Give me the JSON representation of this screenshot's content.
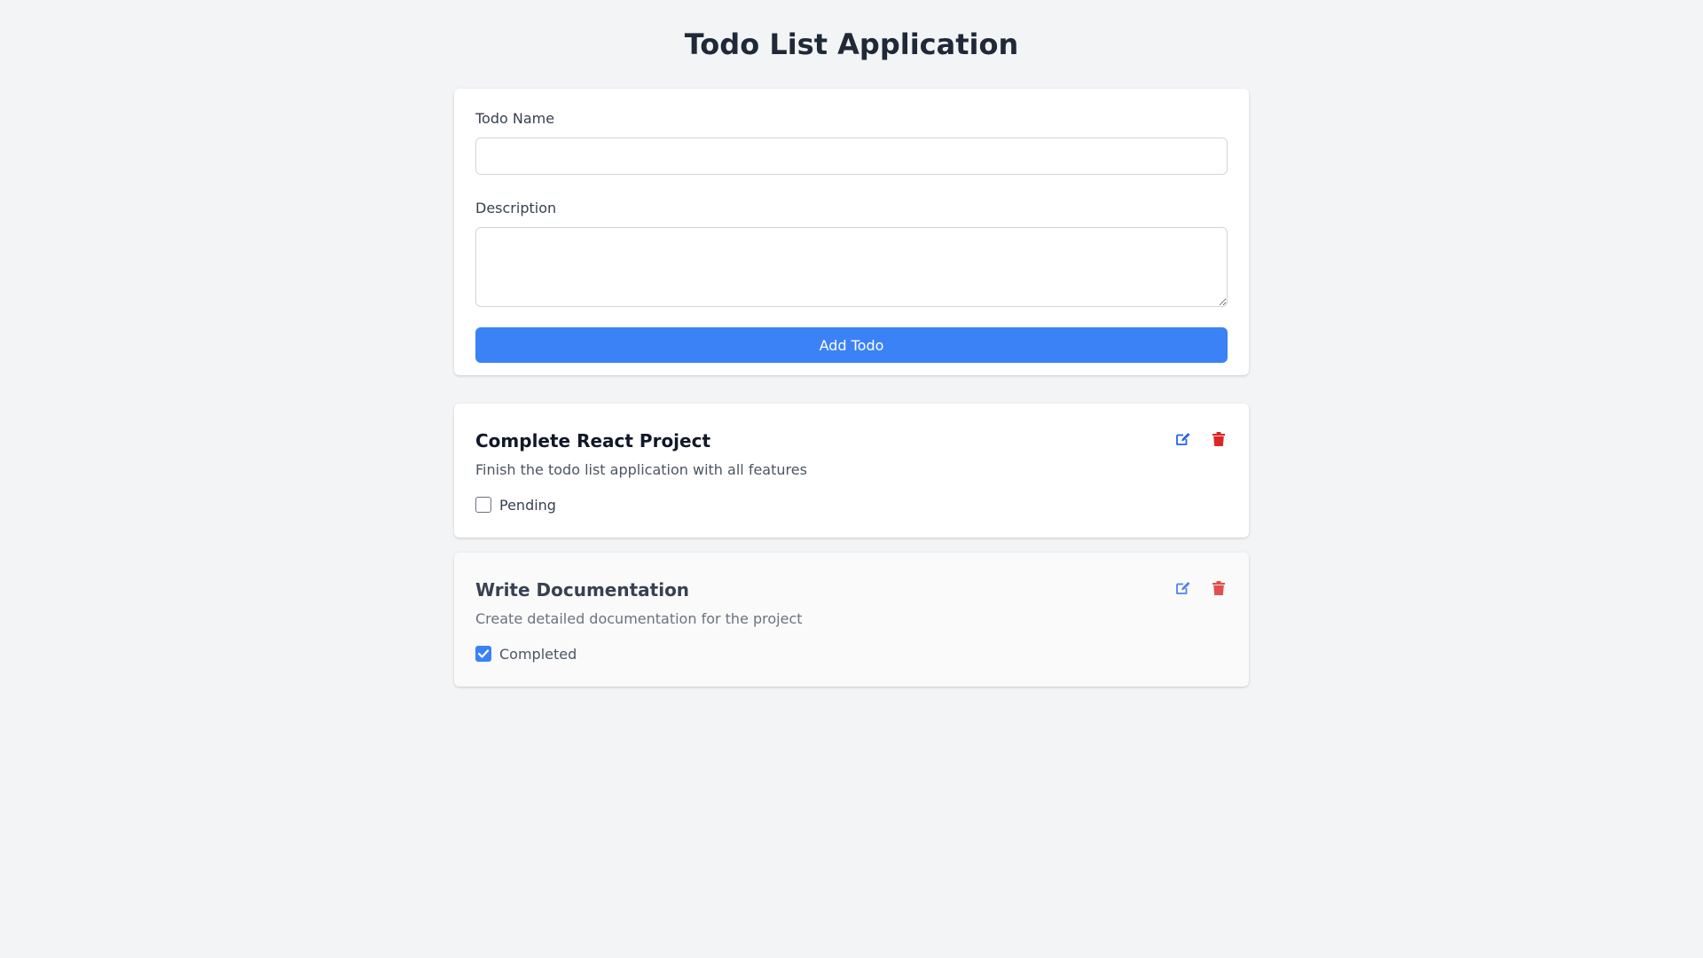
{
  "app": {
    "title": "Todo List Application"
  },
  "form": {
    "name_label": "Todo Name",
    "name_value": "",
    "description_label": "Description",
    "description_value": "",
    "submit_label": "Add Todo"
  },
  "todos": [
    {
      "title": "Complete React Project",
      "description": "Finish the todo list application with all features",
      "status_label": "Pending",
      "completed": false,
      "edit_icon": "edit-icon",
      "delete_icon": "trash-icon"
    },
    {
      "title": "Write Documentation",
      "description": "Create detailed documentation for the project",
      "status_label": "Completed",
      "completed": true,
      "edit_icon": "edit-icon",
      "delete_icon": "trash-icon"
    }
  ],
  "colors": {
    "accent": "#3b82f6",
    "edit": "#2563eb",
    "delete": "#dc2626",
    "background": "#f3f4f6"
  }
}
